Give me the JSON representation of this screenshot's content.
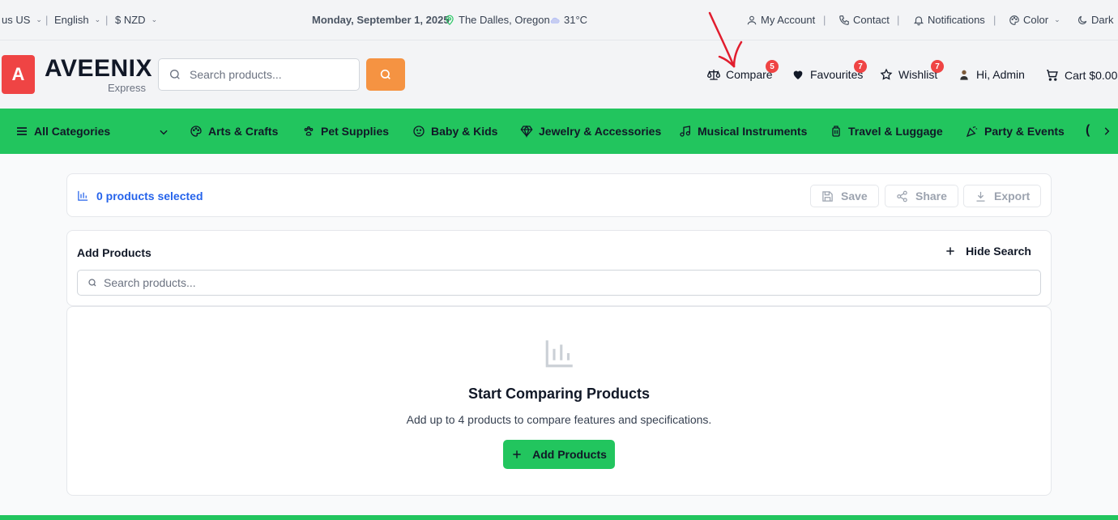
{
  "topbar": {
    "locale": "us US",
    "language": "English",
    "currency": "$ NZD",
    "date": "Monday, September 1, 2025",
    "location": "The Dalles, Oregon",
    "temperature": "31°C",
    "my_account": "My Account",
    "contact": "Contact",
    "notifications": "Notifications",
    "color": "Color",
    "dark": "Dark",
    "separator": "|"
  },
  "header": {
    "logo_letter": "A",
    "logo_name": "AVEENIX",
    "logo_sub": "Express",
    "search_placeholder": "Search products...",
    "compare": "Compare",
    "compare_count": "5",
    "favourites": "Favourites",
    "favourites_count": "7",
    "wishlist": "Wishlist",
    "wishlist_count": "7",
    "user": "Hi, Admin",
    "cart": "Cart $0.00"
  },
  "nav": {
    "all_categories": "All Categories",
    "items": [
      {
        "label": "Arts & Crafts",
        "icon": "palette-icon"
      },
      {
        "label": "Pet Supplies",
        "icon": "paw-icon"
      },
      {
        "label": "Baby & Kids",
        "icon": "baby-icon"
      },
      {
        "label": "Jewelry & Accessories",
        "icon": "gem-icon"
      },
      {
        "label": "Musical Instruments",
        "icon": "music-icon"
      },
      {
        "label": "Travel & Luggage",
        "icon": "luggage-icon"
      },
      {
        "label": "Party & Events",
        "icon": "party-icon"
      }
    ]
  },
  "compare_bar": {
    "selected": "0 products selected",
    "save": "Save",
    "share": "Share",
    "export": "Export"
  },
  "add_panel": {
    "title": "Add Products",
    "hide_search": "Hide Search",
    "search_placeholder": "Search products..."
  },
  "empty_state": {
    "title": "Start Comparing Products",
    "description": "Add up to 4 products to compare features and specifications.",
    "button": "Add Products"
  },
  "colors": {
    "brand_green": "#22c55e",
    "logo_red": "#ef4444",
    "search_orange": "#f59342",
    "link_blue": "#2563eb",
    "annotation_red": "#e11d2e"
  }
}
